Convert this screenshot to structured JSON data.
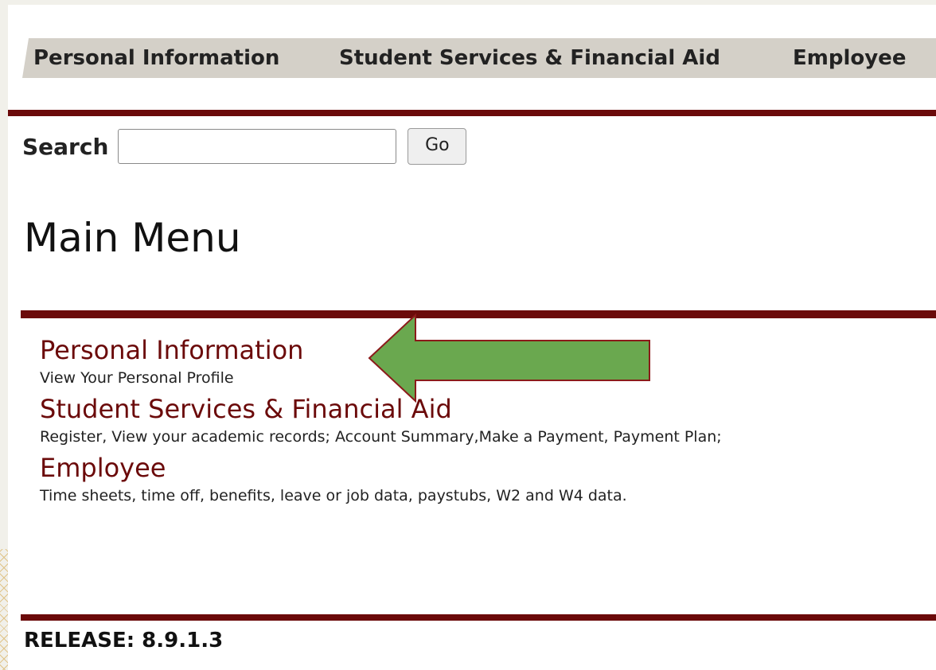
{
  "tabs": [
    {
      "label": "Personal Information"
    },
    {
      "label": "Student Services & Financial Aid"
    },
    {
      "label": "Employee"
    }
  ],
  "search": {
    "label": "Search",
    "value": "",
    "placeholder": "",
    "button_label": "Go"
  },
  "page_title": "Main Menu",
  "menu": {
    "items": [
      {
        "label": "Personal Information",
        "description": "View Your Personal Profile"
      },
      {
        "label": "Student Services & Financial Aid",
        "description": "Register, View your academic records; Account Summary,Make a Payment, Payment Plan;"
      },
      {
        "label": "Employee",
        "description": "Time sheets, time off, benefits, leave or job data, paystubs, W2 and W4 data."
      }
    ]
  },
  "annotation": {
    "arrow_color": "#6aa84f",
    "arrow_border": "#8b1a1a",
    "icon": "left-arrow-icon"
  },
  "release": "RELEASE: 8.9.1.3",
  "colors": {
    "accent": "#6b0a0a",
    "tab_bg": "#d4d0c8"
  }
}
